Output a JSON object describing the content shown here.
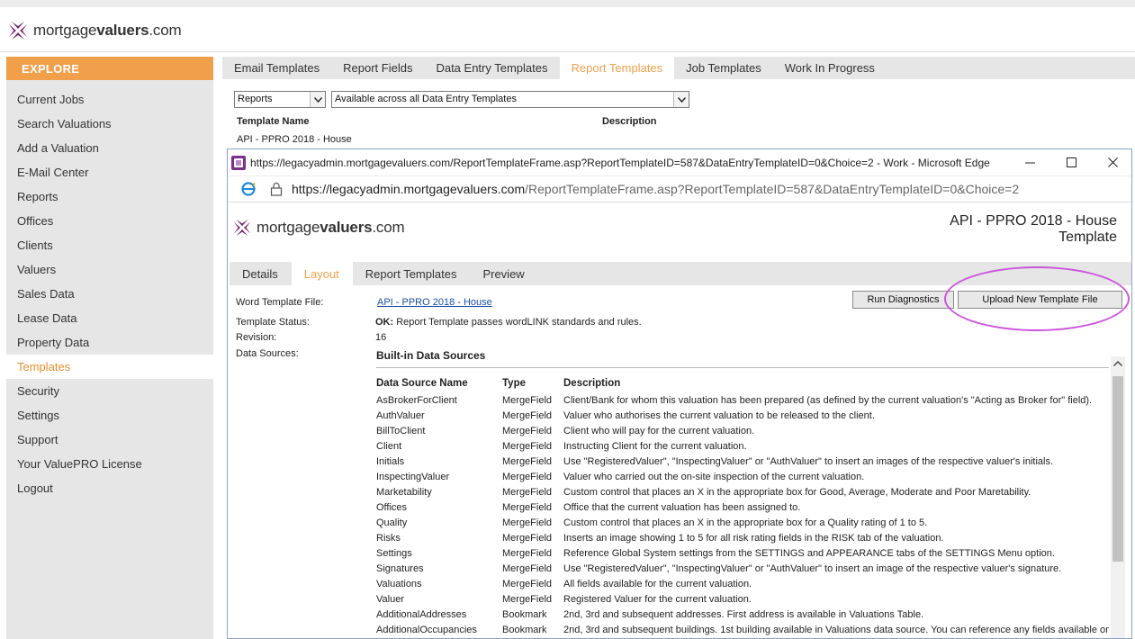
{
  "brand": {
    "name_light": "mortgage",
    "name_bold": "valuers",
    "name_tld": ".com"
  },
  "colors": {
    "accent": "#f0a04b",
    "logo_purple": "#8b2f7a",
    "link": "#1a4fa8",
    "highlight": "#cc55dd"
  },
  "sidebar": {
    "header": "EXPLORE",
    "items": [
      "Current Jobs",
      "Search Valuations",
      "Add a Valuation",
      "E-Mail Center",
      "Reports",
      "Offices",
      "Clients",
      "Valuers",
      "Sales Data",
      "Lease Data",
      "Property Data",
      "Templates",
      "Security",
      "Settings",
      "Support",
      "Your ValuePRO License",
      "Logout"
    ],
    "active_index": 11
  },
  "tabs": {
    "items": [
      "Email Templates",
      "Report Fields",
      "Data Entry Templates",
      "Report Templates",
      "Job Templates",
      "Work In Progress"
    ],
    "active_index": 3
  },
  "filters": {
    "type_value": "Reports",
    "scope_value": "Available across all Data Entry Templates"
  },
  "list": {
    "col_template_name": "Template Name",
    "col_description": "Description",
    "first_row": "API - PPRO 2018 - House"
  },
  "popup": {
    "window_title": "https://legacyadmin.mortgagevaluers.com/ReportTemplateFrame.asp?ReportTemplateID=587&DataEntryTemplateID=0&Choice=2 - Work - Microsoft Edge",
    "url_domain": "https://legacyadmin.mortgagevaluers.com",
    "url_path": "/ReportTemplateFrame.asp?ReportTemplateID=587&DataEntryTemplateID=0&Choice=2",
    "template_title_line1": "API - PPRO 2018 - House",
    "template_title_line2": "Template",
    "tabs": {
      "items": [
        "Details",
        "Layout",
        "Report Templates",
        "Preview"
      ],
      "active_index": 1
    },
    "word_template_label": "Word Template File:",
    "word_template_link": "API - PPRO 2018 - House",
    "status_label": "Template Status:",
    "status_ok": "OK:",
    "status_text": " Report Template passes wordLINK standards and rules.",
    "revision_label": "Revision:",
    "revision_value": "16",
    "data_sources_label": "Data Sources:",
    "run_diagnostics": "Run Diagnostics",
    "upload_new": "Upload New Template File",
    "builtin_heading": "Built-in Data Sources",
    "ds_headers": [
      "Data Source Name",
      "Type",
      "Description"
    ],
    "data_sources": [
      [
        "AsBrokerForClient",
        "MergeField",
        "Client/Bank for whom this valuation has been prepared (as defined by the current valuation's \"Acting as Broker for\" field)."
      ],
      [
        "AuthValuer",
        "MergeField",
        "Valuer who authorises the current valuation to be released to the client."
      ],
      [
        "BillToClient",
        "MergeField",
        "Client who will pay for the current valuation."
      ],
      [
        "Client",
        "MergeField",
        "Instructing Client for the current valuation."
      ],
      [
        "Initials",
        "MergeField",
        "Use \"RegisteredValuer\", \"InspectingValuer\" or \"AuthValuer\" to insert an images of the respective valuer's initials."
      ],
      [
        "InspectingValuer",
        "MergeField",
        "Valuer who carried out the on-site inspection of the current valuation."
      ],
      [
        "Marketability",
        "MergeField",
        "Custom control that places an X in the appropriate box for Good, Average, Moderate and Poor Maretability."
      ],
      [
        "Offices",
        "MergeField",
        "Office that the current valuation has been assigned to."
      ],
      [
        "Quality",
        "MergeField",
        "Custom control that places an X in the appropriate box for a Quality rating of 1 to 5."
      ],
      [
        "Risks",
        "MergeField",
        "Inserts an image showing 1 to 5 for all risk rating fields in the RISK tab of the valuation."
      ],
      [
        "Settings",
        "MergeField",
        "Reference Global System settings from the SETTINGS and APPEARANCE tabs of the SETTINGS Menu option."
      ],
      [
        "Signatures",
        "MergeField",
        "Use \"RegisteredValuer\", \"InspectingValuer\" or \"AuthValuer\" to insert an image of the respective valuer's signature."
      ],
      [
        "Valuations",
        "MergeField",
        "All fields available for the current valuation."
      ],
      [
        "Valuer",
        "MergeField",
        "Registered Valuer for the current valuation."
      ],
      [
        "AdditionalAddresses",
        "Bookmark",
        "2nd, 3rd and subsequent addresses. First address is available in Valuations Table."
      ],
      [
        "AdditionalOccupancies",
        "Bookmark",
        "2nd, 3rd and subsequent buildings. 1st building available in Valuations data source. You can reference any fields available on"
      ]
    ]
  }
}
